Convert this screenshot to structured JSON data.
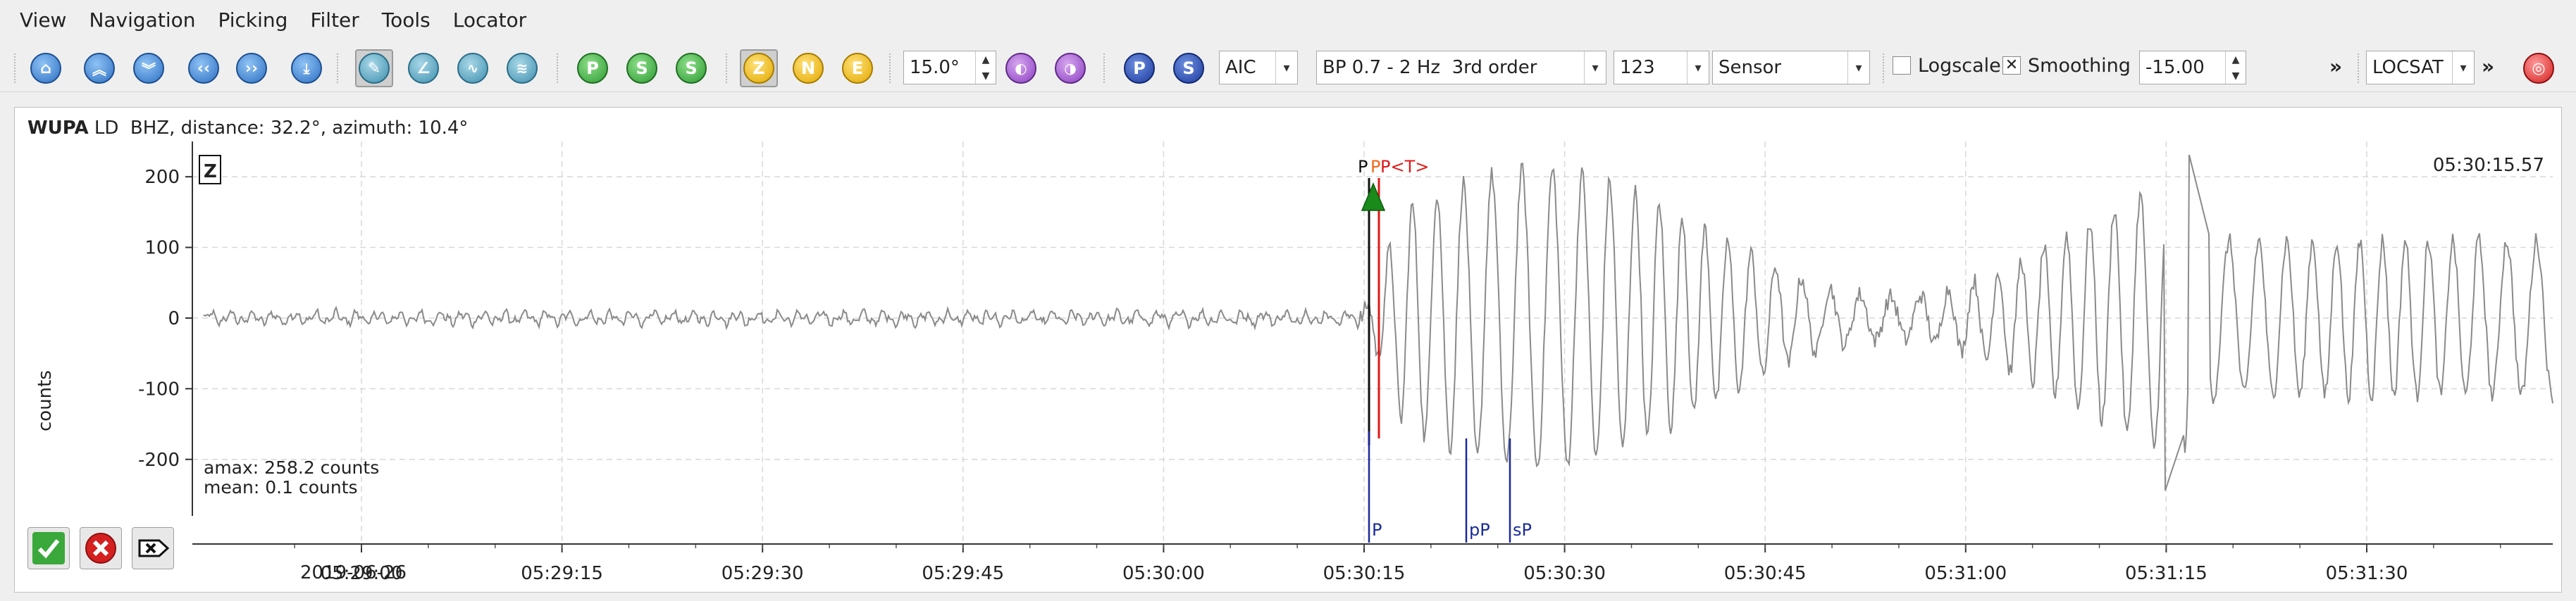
{
  "menu": [
    "View",
    "Navigation",
    "Picking",
    "Filter",
    "Tools",
    "Locator"
  ],
  "toolbar": {
    "angle_value": "15.0°",
    "picker_method": "AIC",
    "filter_value": "BP 0.7 - 2 Hz  3rd order",
    "amplitude_value": "123",
    "unit_value": "Sensor",
    "logscale_label": "Logscale",
    "logscale_checked": false,
    "smoothing_label": "Smoothing",
    "smoothing_checked": true,
    "offset_value": "-15.00",
    "more_glyph": "»",
    "locator_value": "LOCSAT",
    "more2_glyph": "»",
    "comp_z": "Z",
    "comp_n": "N",
    "comp_e": "E",
    "phase_p": "P",
    "phase_s": "S",
    "pick_p": "P",
    "pick_s": "S",
    "pick_s2": "S",
    "check_glyph": "✕"
  },
  "station": {
    "code": "WUPA",
    "details": " LD  BHZ, distance: 32.2°, azimuth: 10.4°"
  },
  "trace": {
    "component_label": "Z",
    "ylabel": "counts",
    "yticks": [
      200,
      100,
      0,
      -100,
      -200
    ],
    "ylim": [
      -260,
      240
    ],
    "amax_text": "amax: 258.2 counts",
    "mean_text": "mean: 0.1 counts",
    "time_readout": "05:30:15.57",
    "date": "2019-06-26",
    "xticks": [
      "05:29:00",
      "05:29:15",
      "05:29:30",
      "05:29:45",
      "05:30:00",
      "05:30:15",
      "05:30:30",
      "05:30:45",
      "05:31:00",
      "05:31:15",
      "05:31:30"
    ],
    "top_picks": [
      {
        "text": "P",
        "color": "#111111"
      },
      {
        "text": "P",
        "color": "#f06a1a"
      },
      {
        "text": "P<T>",
        "color": "#e01818"
      }
    ],
    "theoretical_phases": [
      {
        "label": "P"
      },
      {
        "label": "pP"
      },
      {
        "label": "sP"
      }
    ]
  },
  "colors": {
    "trace": "#8a8a8a",
    "grid": "#d8d8d8",
    "pick_marker": "#1a8a1a",
    "theory": "#1a2a9a",
    "manual_pick": "#e01818"
  }
}
